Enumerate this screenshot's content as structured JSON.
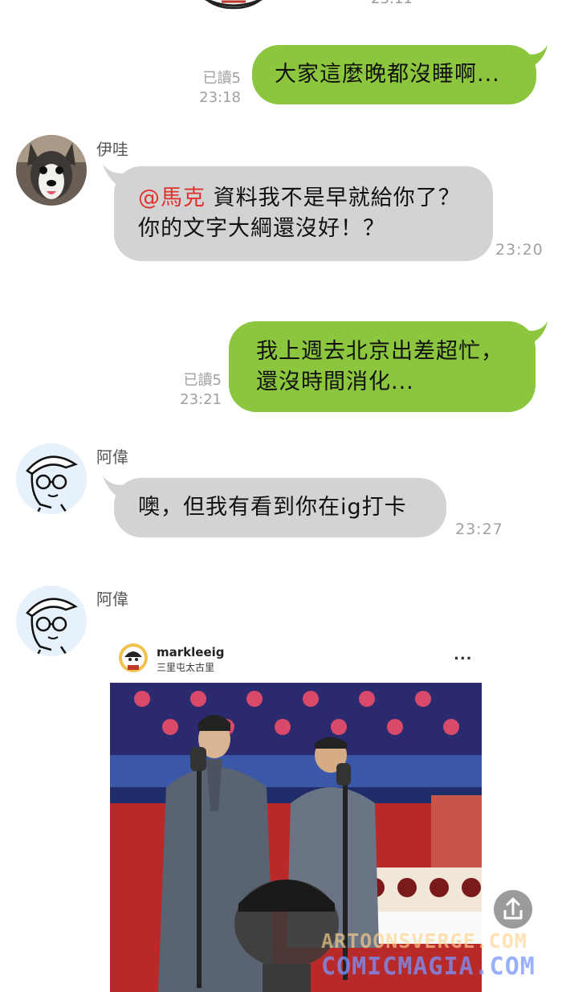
{
  "top": {
    "timestamp": "23:11"
  },
  "messages": {
    "m1": {
      "text": "大家這麼晚都沒睡啊...",
      "read": "已讀5",
      "time": "23:18"
    },
    "m2": {
      "sender": "伊哇",
      "mention": "@馬克",
      "line1": " 資料我不是早就給你了？",
      "line2": "你的文字大綱還沒好！？",
      "time": "23:20"
    },
    "m3": {
      "line1": "我上週去北京出差超忙，",
      "line2": "還沒時間消化...",
      "read": "已讀5",
      "time": "23:21"
    },
    "m4": {
      "sender": "阿偉",
      "text": "噢，但我有看到你在ig打卡",
      "time": "23:27"
    },
    "m5": {
      "sender": "阿偉"
    }
  },
  "ig_post": {
    "username": "markleeig",
    "location": "三里屯太古里",
    "more": "..."
  },
  "watermark": {
    "line1": "ARTOONSVERGE.COM",
    "line2": "COMICMAGIA.COM"
  },
  "icons": {
    "share": "share-icon",
    "more": "more-icon"
  },
  "colors": {
    "outgoing_bubble": "#8cc63f",
    "incoming_bubble": "#d3d3d3",
    "mention": "#e0322d"
  }
}
